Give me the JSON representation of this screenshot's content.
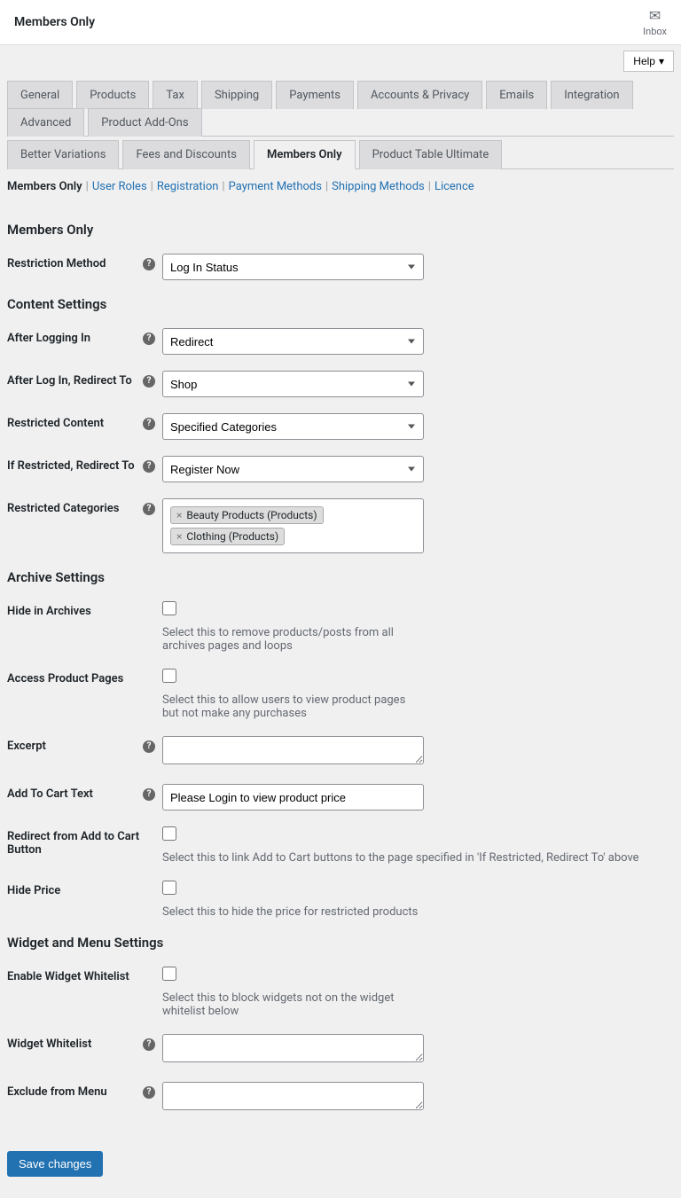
{
  "header": {
    "title": "Members Only",
    "inbox_label": "Inbox",
    "help_label": "Help"
  },
  "tabs": {
    "row1": [
      "General",
      "Products",
      "Tax",
      "Shipping",
      "Payments",
      "Accounts & Privacy",
      "Emails",
      "Integration",
      "Advanced",
      "Product Add-Ons"
    ],
    "row2": [
      "Better Variations",
      "Fees and Discounts",
      "Members Only",
      "Product Table Ultimate"
    ],
    "active": "Members Only"
  },
  "subnav": {
    "items": [
      "Members Only",
      "User Roles",
      "Registration",
      "Payment Methods",
      "Shipping Methods",
      "Licence"
    ],
    "current": "Members Only"
  },
  "sections": {
    "s1": "Members Only",
    "s2": "Content Settings",
    "s3": "Archive Settings",
    "s4": "Widget and Menu Settings"
  },
  "fields": {
    "restriction_method": {
      "label": "Restriction Method",
      "value": "Log In Status"
    },
    "after_logging_in": {
      "label": "After Logging In",
      "value": "Redirect"
    },
    "after_login_redirect": {
      "label": "After Log In, Redirect To",
      "value": "Shop"
    },
    "restricted_content": {
      "label": "Restricted Content",
      "value": "Specified Categories"
    },
    "if_restricted_redirect": {
      "label": "If Restricted, Redirect To",
      "value": "Register Now"
    },
    "restricted_categories": {
      "label": "Restricted Categories",
      "tags": [
        "Beauty Products (Products)",
        "Clothing (Products)"
      ]
    },
    "hide_in_archives": {
      "label": "Hide in Archives",
      "desc": "Select this to remove products/posts from all archives pages and loops"
    },
    "access_product_pages": {
      "label": "Access Product Pages",
      "desc": "Select this to allow users to view product pages but not make any purchases"
    },
    "excerpt": {
      "label": "Excerpt",
      "value": ""
    },
    "add_to_cart_text": {
      "label": "Add To Cart Text",
      "value": "Please Login to view product price"
    },
    "redirect_from_atc": {
      "label": "Redirect from Add to Cart Button",
      "desc": "Select this to link Add to Cart buttons to the page specified in 'If Restricted, Redirect To' above"
    },
    "hide_price": {
      "label": "Hide Price",
      "desc": "Select this to hide the price for restricted products"
    },
    "enable_widget_whitelist": {
      "label": "Enable Widget Whitelist",
      "desc": "Select this to block widgets not on the widget whitelist below"
    },
    "widget_whitelist": {
      "label": "Widget Whitelist",
      "value": ""
    },
    "exclude_from_menu": {
      "label": "Exclude from Menu",
      "value": ""
    }
  },
  "save_label": "Save changes"
}
